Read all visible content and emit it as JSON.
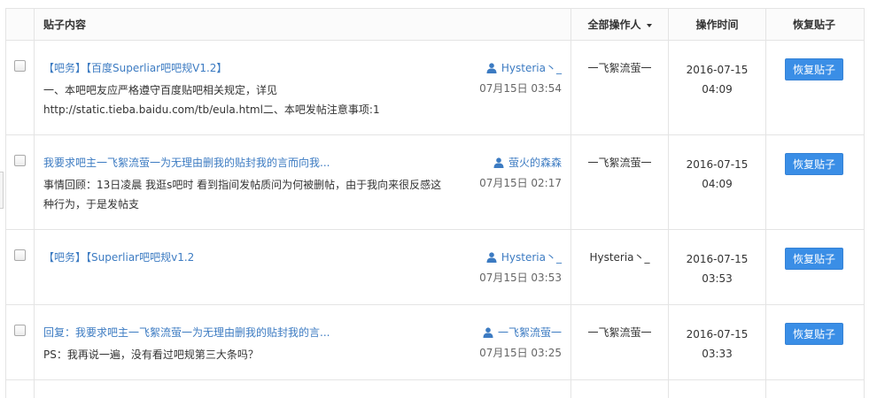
{
  "header": {
    "content": "贴子内容",
    "operator": "全部操作人",
    "time": "操作时间",
    "restore": "恢复贴子"
  },
  "rows": [
    {
      "title": "【吧务】【百度Superliar吧吧规V1.2】",
      "body": "一、本吧吧友应严格遵守百度贴吧相关规定，详见 http://static.tieba.baidu.com/tb/eula.html二、本吧发帖注意事项:1",
      "author": "Hysteria丶_",
      "date": "07月15日 03:54",
      "operator": "一飞絮流萤一",
      "time_date": "2016-07-15",
      "time_clock": "04:09",
      "button": "恢复贴子"
    },
    {
      "title": "我要求吧主一飞絮流萤一为无理由删我的贴封我的言而向我...",
      "body": "事情回顾：13日凌晨 我逛s吧时 看到指间发帖质问为何被删帖，由于我向来很反感这种行为，于是发帖支",
      "author": "萤火的森森",
      "date": "07月15日 02:17",
      "operator": "一飞絮流萤一",
      "time_date": "2016-07-15",
      "time_clock": "04:09",
      "button": "恢复贴子"
    },
    {
      "title": "【吧务】【Superliar吧吧规v1.2",
      "body": "",
      "author": "Hysteria丶_",
      "date": "07月15日 03:53",
      "operator": "Hysteria丶_",
      "time_date": "2016-07-15",
      "time_clock": "03:53",
      "button": "恢复贴子"
    },
    {
      "title": "回复：我要求吧主一飞絮流萤一为无理由删我的贴封我的言...",
      "body": "PS：我再说一遍，没有看过吧规第三大条吗？",
      "author": "一飞絮流萤一",
      "date": "07月15日 03:25",
      "operator": "一飞絮流萤一",
      "time_date": "2016-07-15",
      "time_clock": "03:33",
      "button": "恢复贴子"
    }
  ],
  "colors": {
    "link": "#3c7bc2",
    "button": "#3a8ee6",
    "border": "#e4e4e4"
  }
}
